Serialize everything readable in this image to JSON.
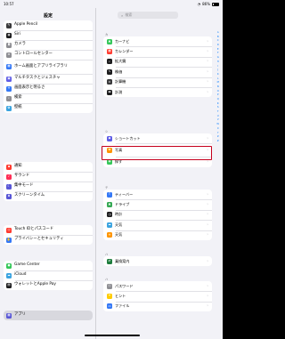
{
  "status_bar": {
    "time": "10:57",
    "battery": "86%"
  },
  "left": {
    "title": "設定",
    "groups": [
      {
        "items": [
          {
            "label": "Apple Pencil",
            "icon": "pencil-icon",
            "color": "#3a3a3c"
          },
          {
            "label": "Siri",
            "icon": "siri-icon",
            "color": "#1c1c1e"
          },
          {
            "label": "カメラ",
            "icon": "camera-icon",
            "color": "#8e8e93"
          },
          {
            "label": "コントロールセンター",
            "icon": "control-center-icon",
            "color": "#8e8e93"
          },
          {
            "label": "ホーム画面とアプリライブラリ",
            "icon": "home-screen-icon",
            "color": "#3478f6"
          },
          {
            "label": "マルチタスクとジェスチャ",
            "icon": "multitask-icon",
            "color": "#5e5ce6"
          },
          {
            "label": "画面表示と明るさ",
            "icon": "brightness-icon",
            "color": "#3478f6"
          },
          {
            "label": "検索",
            "icon": "search-icon",
            "color": "#8e8e93"
          },
          {
            "label": "壁紙",
            "icon": "wallpaper-icon",
            "color": "#3aa3e0"
          }
        ]
      },
      {
        "items": [
          {
            "label": "通知",
            "icon": "notifications-icon",
            "color": "#ff3b30"
          },
          {
            "label": "サウンド",
            "icon": "sound-icon",
            "color": "#ff2d55"
          },
          {
            "label": "集中モード",
            "icon": "focus-icon",
            "color": "#5856d6"
          },
          {
            "label": "スクリーンタイム",
            "icon": "screen-time-icon",
            "color": "#5856d6"
          }
        ]
      },
      {
        "items": [
          {
            "label": "Touch IDとパスコード",
            "icon": "touch-id-icon",
            "color": "#ff3b30"
          },
          {
            "label": "プライバシーとセキュリティ",
            "icon": "privacy-icon",
            "color": "#3478f6"
          }
        ]
      },
      {
        "items": [
          {
            "label": "Game Center",
            "icon": "game-center-icon",
            "color": "#34c759"
          },
          {
            "label": "iCloud",
            "icon": "icloud-icon",
            "color": "#3aa3e0"
          },
          {
            "label": "ウォレットとApple Pay",
            "icon": "wallet-icon",
            "color": "#1c1c1e"
          }
        ]
      },
      {
        "items": [
          {
            "label": "アプリ",
            "icon": "apps-icon",
            "color": "#5856d6"
          }
        ]
      }
    ]
  },
  "right": {
    "search_placeholder": "検索",
    "index": [
      "A",
      "B",
      "C",
      "D",
      "E",
      "F",
      "G",
      "H",
      "I",
      "J",
      "K",
      "L",
      "M",
      "N",
      "O",
      "P",
      "Q",
      "R",
      "S",
      "T",
      "U",
      "V",
      "W",
      "X",
      "Y",
      "Z",
      "#"
    ],
    "sections": [
      {
        "header": "カ",
        "items": [
          {
            "label": "カーナビ",
            "icon": "carnavi-icon",
            "color": "#34c759"
          },
          {
            "label": "カレンダー",
            "icon": "calendar-icon",
            "color": "#ff3b30"
          },
          {
            "label": "拡大鏡",
            "icon": "magnifier-icon",
            "color": "#1c1c1e"
          },
          {
            "label": "株価",
            "icon": "stocks-icon",
            "color": "#1c1c1e"
          },
          {
            "label": "計算機",
            "icon": "calculator-icon",
            "color": "#3a3a3c"
          },
          {
            "label": "計測",
            "icon": "measure-icon",
            "color": "#1c1c1e"
          }
        ]
      },
      {
        "header": "シ",
        "items": [
          {
            "label": "ショートカット",
            "icon": "shortcuts-icon",
            "color": "#5e5ce6"
          },
          {
            "label": "写真",
            "icon": "photos-icon",
            "color": "#ff9500"
          },
          {
            "label": "探す",
            "icon": "find-my-icon",
            "color": "#34c759"
          }
        ]
      },
      {
        "header": "テ",
        "items": [
          {
            "label": "ティーバー",
            "icon": "tver-icon",
            "color": "#3478f6"
          },
          {
            "label": "ドライブ",
            "icon": "drive-icon",
            "color": "#34a853"
          },
          {
            "label": "時計",
            "icon": "clock-icon",
            "color": "#1c1c1e"
          },
          {
            "label": "天気",
            "icon": "weather-icon",
            "color": "#3aa3e0"
          },
          {
            "label": "天気",
            "icon": "weather-icon",
            "color": "#ff9500"
          }
        ]
      },
      {
        "header": "ハ",
        "items": [
          {
            "label": "乗換案内",
            "icon": "transit-icon",
            "color": "#1c7c3c"
          }
        ]
      },
      {
        "header": "ハ",
        "items": [
          {
            "label": "パスワード",
            "icon": "passwords-icon",
            "color": "#8e8e93"
          },
          {
            "label": "ヒント",
            "icon": "tips-icon",
            "color": "#ffcc00"
          },
          {
            "label": "ファイル",
            "icon": "files-icon",
            "color": "#3478f6"
          }
        ]
      }
    ],
    "highlight_color": "#c6001d"
  }
}
